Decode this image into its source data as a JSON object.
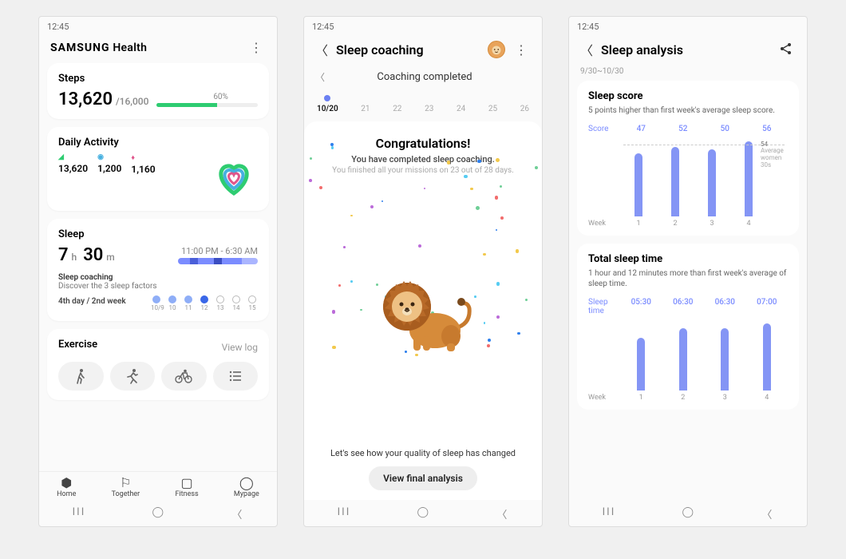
{
  "time": "12:45",
  "screen1": {
    "brand_samsung": "SAMSUNG",
    "brand_health": "Health",
    "steps": {
      "title": "Steps",
      "value": "13,620",
      "goal": "/16,000",
      "pct_label": "60%",
      "pct": 60
    },
    "activity": {
      "title": "Daily Activity",
      "metrics": [
        {
          "icon": "👟",
          "color": "#2ecc71",
          "value": "13,620"
        },
        {
          "icon": "●",
          "color": "#46b0e0",
          "value": "1,200"
        },
        {
          "icon": "▲",
          "color": "#e0558b",
          "value": "1,160"
        }
      ]
    },
    "sleep": {
      "title": "Sleep",
      "h": "7",
      "h_unit": "h",
      "m": "30",
      "m_unit": "m",
      "window": "11:00 PM - 6:30 AM",
      "coaching_title": "Sleep coaching",
      "coaching_desc": "Discover the 3 sleep factors",
      "coaching_progress": "4th day / 2nd week",
      "days": [
        "10/9",
        "10",
        "11",
        "12",
        "13",
        "14",
        "15"
      ]
    },
    "exercise": {
      "title": "Exercise",
      "viewlog": "View log"
    },
    "tabs": [
      "Home",
      "Together",
      "Fitness",
      "Mypage"
    ]
  },
  "screen2": {
    "title": "Sleep coaching",
    "subtitle": "Coaching completed",
    "dates": [
      "10/20",
      "21",
      "22",
      "23",
      "24",
      "25",
      "26"
    ],
    "congrats": "Congratulations!",
    "line1": "You have completed sleep coaching.",
    "line2": "You finished all your missions on 23 out of 28 days.",
    "quality": "Let's see how your quality of sleep has changed",
    "button": "View final analysis"
  },
  "screen3": {
    "title": "Sleep analysis",
    "range": "9/30~10/30",
    "score": {
      "title": "Sleep score",
      "desc": "5 points higher than first week's average sleep score.",
      "head_label": "Score",
      "values": [
        "47",
        "52",
        "50",
        "56"
      ],
      "avg_value": "54",
      "avg_label": "Average women 30s",
      "xaxis_label": "Week",
      "weeks": [
        "1",
        "2",
        "3",
        "4"
      ]
    },
    "total": {
      "title": "Total sleep time",
      "desc": "1 hour and 12 minutes more than first week's average of sleep time.",
      "head_label": "Sleep time",
      "values": [
        "05:30",
        "06:30",
        "06:30",
        "07:00"
      ],
      "xaxis_label": "Week",
      "weeks": [
        "1",
        "2",
        "3",
        "4"
      ]
    }
  },
  "chart_data": [
    {
      "type": "bar",
      "title": "Sleep score",
      "categories": [
        "1",
        "2",
        "3",
        "4"
      ],
      "values": [
        47,
        52,
        50,
        56
      ],
      "xlabel": "Week",
      "ylabel": "Score",
      "annotations": [
        {
          "type": "hline",
          "y": 54,
          "label": "Average women 30s"
        }
      ],
      "ylim": [
        0,
        60
      ]
    },
    {
      "type": "bar",
      "title": "Total sleep time",
      "categories": [
        "1",
        "2",
        "3",
        "4"
      ],
      "values": [
        330,
        390,
        390,
        420
      ],
      "value_labels": [
        "05:30",
        "06:30",
        "06:30",
        "07:00"
      ],
      "xlabel": "Week",
      "ylabel": "Sleep time",
      "ylim": [
        0,
        450
      ]
    }
  ]
}
